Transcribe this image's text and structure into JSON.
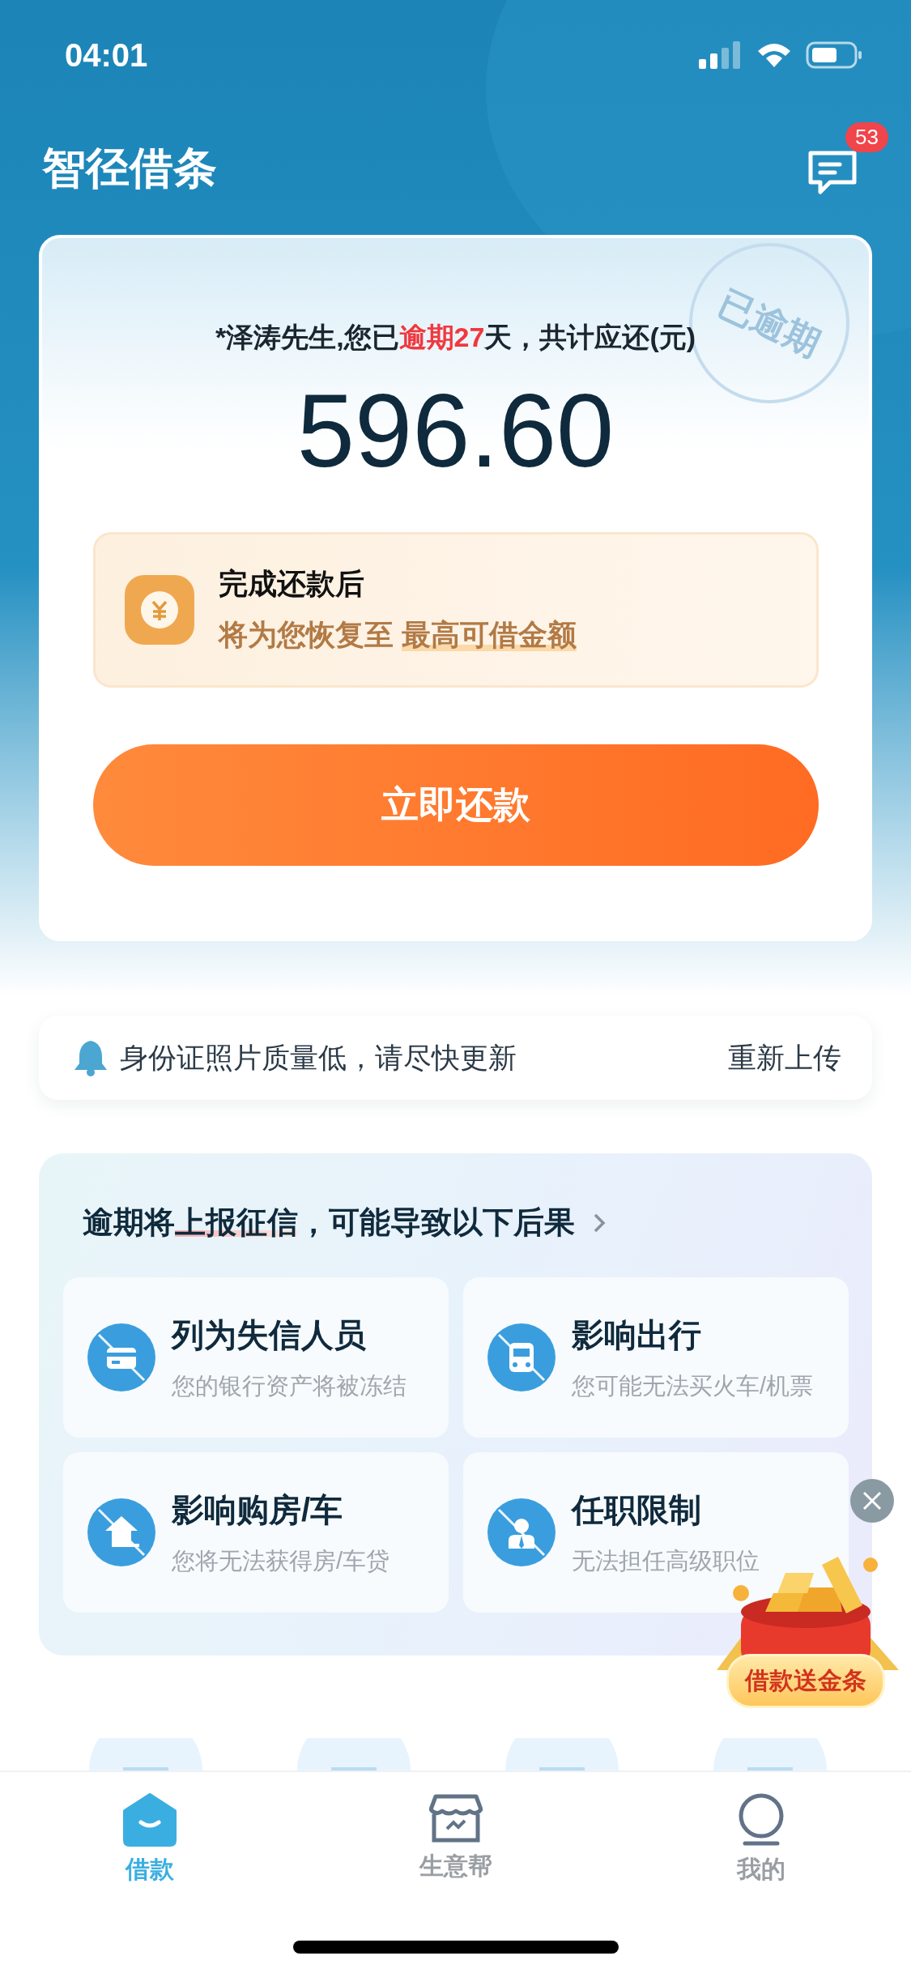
{
  "status_bar": {
    "time": "04:01"
  },
  "header": {
    "title": "智径借条",
    "messages_badge": "53"
  },
  "overdue_card": {
    "stamp": "已逾期",
    "greeting": [
      {
        "text": "*泽涛先生,您已",
        "highlight": false
      },
      {
        "text": "逾期27",
        "highlight": true
      },
      {
        "text": "天，共计应还(元)",
        "highlight": false
      }
    ],
    "amount": "596.60",
    "promo": {
      "title": "完成还款后",
      "text": "将为您恢复至",
      "highlight": "最高可借金额"
    },
    "button": "立即还款"
  },
  "notice": {
    "text": "身份证照片质量低，请尽快更新",
    "action": "重新上传"
  },
  "consequences": {
    "title": [
      {
        "text": "逾期将",
        "underline": false
      },
      {
        "text": "上报征信",
        "underline": true
      },
      {
        "text": "，可能导致以下后果",
        "underline": false
      }
    ],
    "items": [
      {
        "kind": "card",
        "title": "列为失信人员",
        "desc": "您的银行资产将被冻结"
      },
      {
        "kind": "train",
        "title": "影响出行",
        "desc": "您可能无法买火车/机票"
      },
      {
        "kind": "house",
        "title": "影响购房/车",
        "desc": "您将无法获得房/车贷"
      },
      {
        "kind": "person",
        "title": "任职限制",
        "desc": "无法担任高级职位"
      }
    ]
  },
  "floating_promo": {
    "label": "借款送金条"
  },
  "tab_bar": [
    {
      "kind": "home",
      "label": "借款",
      "selected": true
    },
    {
      "kind": "shop",
      "label": "生意帮",
      "selected": false
    },
    {
      "kind": "profile",
      "label": "我的",
      "selected": false
    }
  ]
}
